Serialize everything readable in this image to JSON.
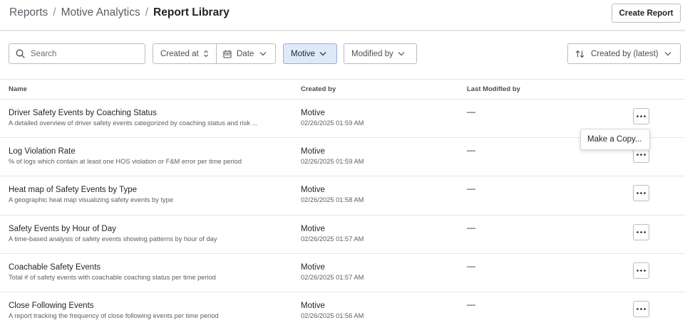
{
  "breadcrumb": {
    "items": [
      "Reports",
      "Motive Analytics"
    ],
    "separator": "/",
    "current": "Report Library"
  },
  "header": {
    "create_label": "Create Report"
  },
  "filters": {
    "search_placeholder": "Search",
    "created_at": "Created at",
    "date": "Date",
    "motive": "Motive",
    "modified_by": "Modified by",
    "sort": "Created by (latest)"
  },
  "table": {
    "columns": [
      "Name",
      "Created by",
      "Last Modified by"
    ],
    "rows": [
      {
        "name": "Driver Safety Events by Coaching Status",
        "description": "A detailed overview of driver safety events categorized by coaching status and risk ...",
        "created_by": "Motive",
        "created_at": "02/26/2025 01:59 AM",
        "modified_by": "—"
      },
      {
        "name": "Log Violation Rate",
        "description": "% of logs which contain at least one HOS violation or F&M error per time period",
        "created_by": "Motive",
        "created_at": "02/26/2025 01:59 AM",
        "modified_by": "—"
      },
      {
        "name": "Heat map of Safety Events by Type",
        "description": "A geographic heat map visualizing safety events by type",
        "created_by": "Motive",
        "created_at": "02/26/2025 01:58 AM",
        "modified_by": "—"
      },
      {
        "name": "Safety Events by Hour of Day",
        "description": "A time-based analysis of safety events showing patterns by hour of day",
        "created_by": "Motive",
        "created_at": "02/26/2025 01:57 AM",
        "modified_by": "—"
      },
      {
        "name": "Coachable Safety Events",
        "description": "Total # of safety events with coachable coaching status per time period",
        "created_by": "Motive",
        "created_at": "02/26/2025 01:57 AM",
        "modified_by": "—"
      },
      {
        "name": "Close Following Events",
        "description": "A report tracking the frequency of close following events per time period",
        "created_by": "Motive",
        "created_at": "02/26/2025 01:56 AM",
        "modified_by": "—"
      }
    ]
  },
  "menu": {
    "make_copy": "Make a Copy..."
  },
  "colors": {
    "accent_bg": "#dfeaf9",
    "accent_border": "#8fb0e0",
    "border": "#b9bdc2"
  }
}
